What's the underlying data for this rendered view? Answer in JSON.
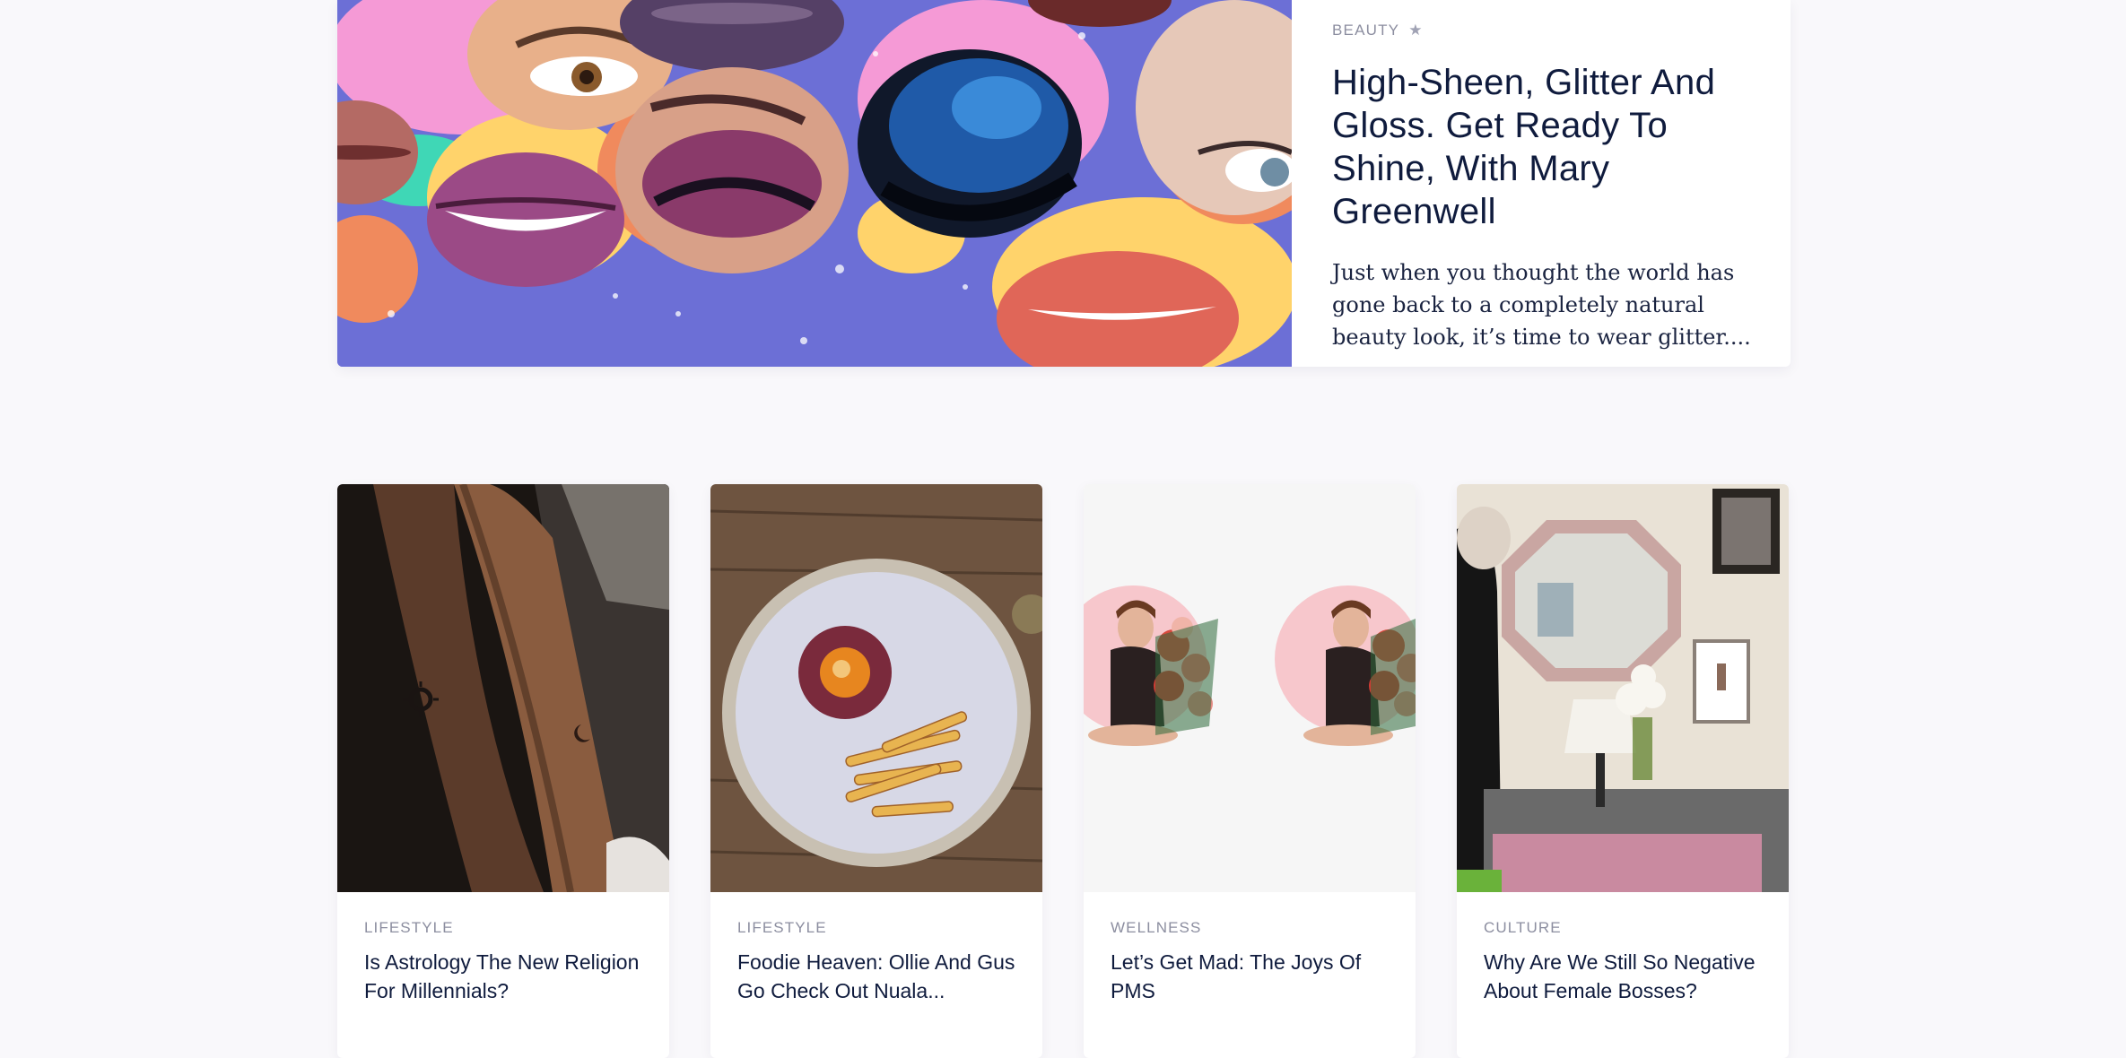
{
  "featured": {
    "category": "BEAUTY",
    "star_icon": "star-icon",
    "title": "High-Sheen, Glitter And Gloss. Get Ready To Shine, With Mary Greenwell",
    "excerpt": "Just when you thought the world has gone back to a completely natural beauty look, it’s time to wear glitter....",
    "image": "makeup-collage-image"
  },
  "cards": [
    {
      "category": "LIFESTYLE",
      "title": "Is Astrology The New Religion For Millennials?",
      "image": "forearm-tattoos-image"
    },
    {
      "category": "LIFESTYLE",
      "title": "Foodie Heaven: Ollie And Gus Go Check Out Nuala...",
      "image": "steak-tartare-plate-image"
    },
    {
      "category": "WELLNESS",
      "title": "Let’s Get Mad: The Joys Of PMS",
      "image": "woman-with-flowers-collage-image"
    },
    {
      "category": "CULTURE",
      "title": "Why Are We Still So Negative About Female Bosses?",
      "image": "office-mirror-scene-image"
    }
  ],
  "colors": {
    "background": "#f9f8fb",
    "text": "#0f1b3d",
    "muted": "#8c8ea0",
    "card": "#ffffff"
  }
}
